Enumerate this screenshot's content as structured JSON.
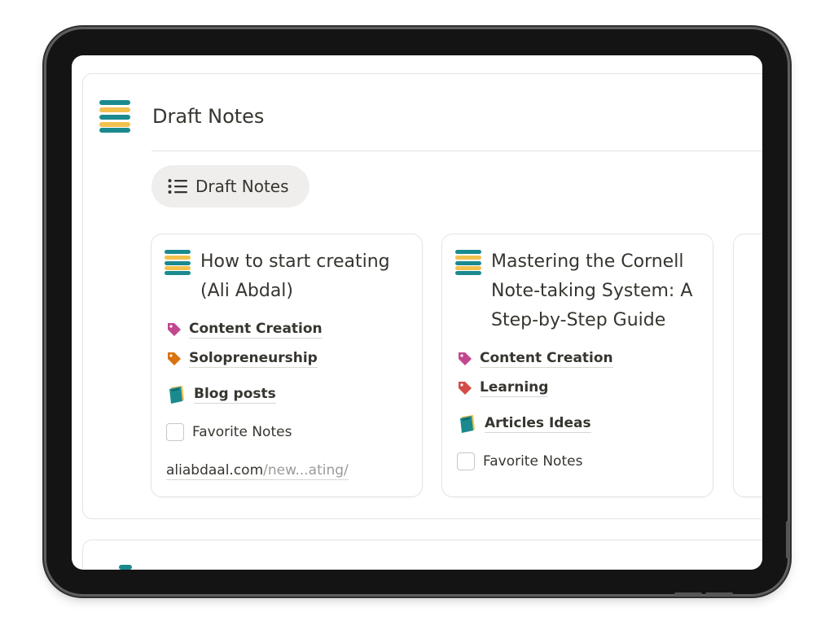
{
  "page": {
    "title": "Draft Notes",
    "view_tab_label": "Draft Notes"
  },
  "cards": [
    {
      "title": "How to start creating (Ali Abdal)",
      "tags": [
        {
          "label": "Content Creation",
          "color": "#c2478f"
        },
        {
          "label": "Solopreneurship",
          "color": "#d9730d"
        }
      ],
      "category": "Blog posts",
      "favorite_label": "Favorite Notes",
      "favorite_checked": false,
      "url_host": "aliabdaal.com",
      "url_path": "/new...ating/"
    },
    {
      "title": "Mastering the Cornell Note-taking System: A Step-by-Step Guide",
      "tags": [
        {
          "label": "Content Creation",
          "color": "#c2478f"
        },
        {
          "label": "Learning",
          "color": "#d44c47"
        }
      ],
      "category": "Articles Ideas",
      "favorite_label": "Favorite Notes",
      "favorite_checked": false
    }
  ],
  "icons": {
    "page_icon": "striped-list-icon",
    "view_icon": "bulleted-list-icon",
    "tag_icon": "tag-icon",
    "category_icon": "book-icon"
  },
  "colors": {
    "teal": "#1b8a8f",
    "yellow": "#f2c14e",
    "frame": "#141414"
  }
}
